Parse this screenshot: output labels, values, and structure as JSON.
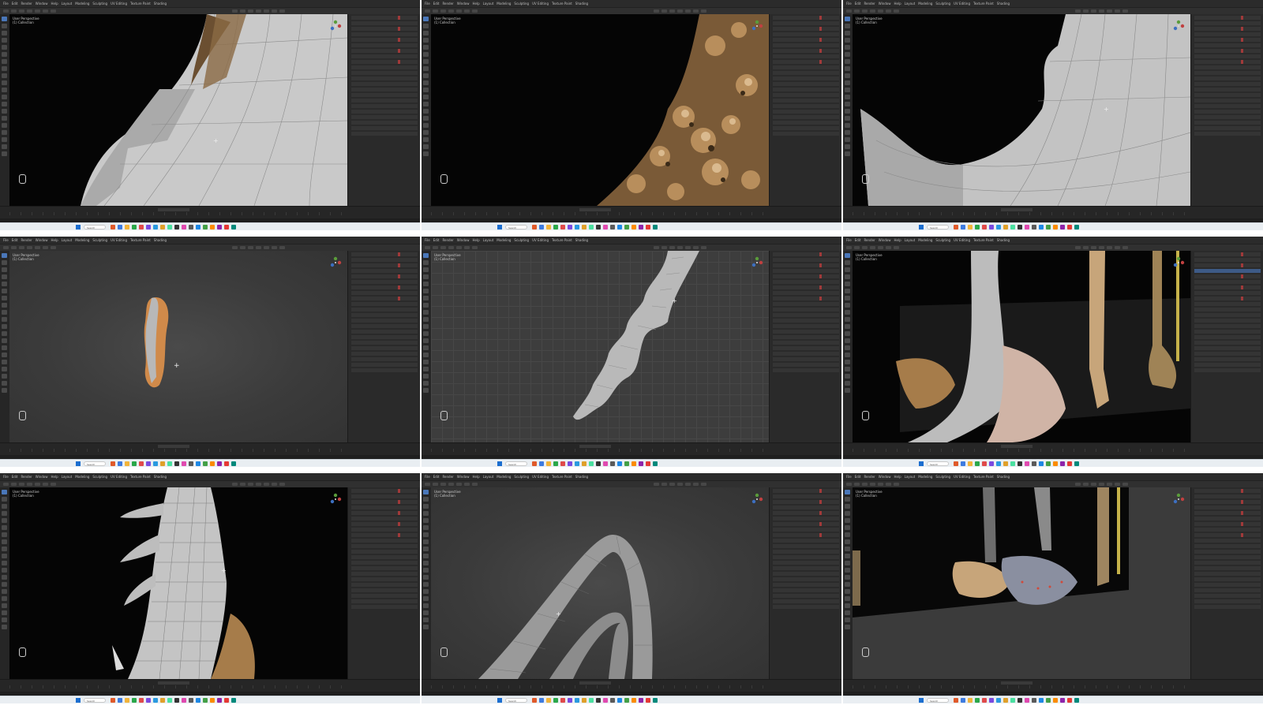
{
  "window": {
    "title": "Blender",
    "menu": [
      "File",
      "Edit",
      "Render",
      "Window",
      "Help",
      "Layout",
      "Modeling",
      "Sculpting",
      "UV Editing",
      "Texture Paint",
      "Shading"
    ]
  },
  "viewport": {
    "header_line1": "User Perspective",
    "header_line2": "(1) Collection"
  },
  "taskbar": {
    "search_label": "Search",
    "clock_time": "",
    "clock_date": ""
  },
  "tiles": [
    {
      "id": "t1",
      "scene": "grey-mesh-blade-edge",
      "bg": "black"
    },
    {
      "id": "t2",
      "scene": "bronze-sculpt-closeup",
      "bg": "black"
    },
    {
      "id": "t3",
      "scene": "curved-blade-mesh",
      "bg": "black"
    },
    {
      "id": "t4",
      "scene": "small-orange-piece",
      "bg": "grey"
    },
    {
      "id": "t5",
      "scene": "wavy-blade-profile",
      "bg": "grid"
    },
    {
      "id": "t6",
      "scene": "axes-in-scene",
      "bg": "black"
    },
    {
      "id": "t7",
      "scene": "spiked-handle-wireframe",
      "bg": "black"
    },
    {
      "id": "t8",
      "scene": "curved-loops-wireframe",
      "bg": "grey"
    },
    {
      "id": "t9",
      "scene": "axe-lineup",
      "bg": "black"
    }
  ],
  "colors": {
    "blender_dark": "#1d1d1d",
    "panel": "#2a2a2a",
    "selection_blue": "#4a77b9",
    "mesh_grey": "#bcbcbc",
    "bronze": "#a67c4a",
    "orange_face": "#d08a4a",
    "taskbar": "#e9eef2"
  }
}
